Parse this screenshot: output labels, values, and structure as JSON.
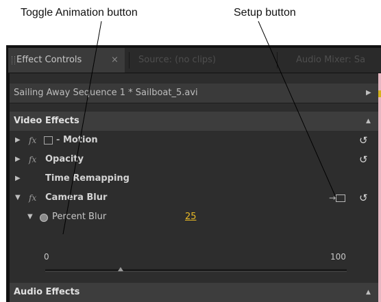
{
  "callouts": {
    "toggle_animation": "Toggle Animation button",
    "setup": "Setup button"
  },
  "tabs": [
    {
      "label": "Effect Controls",
      "active": true,
      "close": "×"
    },
    {
      "label": "Source: (no clips)",
      "active": false
    },
    {
      "label": "Audio Mixer: Sa",
      "active": false
    }
  ],
  "sequence": {
    "label": "Sailing Away Sequence 1 * Sailboat_5.avi"
  },
  "video_effects": {
    "header": "Video Effects",
    "items": [
      {
        "label": "Motion",
        "fx": "fx",
        "expanded": false,
        "has_reset": true
      },
      {
        "label": "Opacity",
        "fx": "fx",
        "expanded": false,
        "has_reset": true
      },
      {
        "label": "Time Remapping",
        "fx": "",
        "expanded": false,
        "has_reset": false
      },
      {
        "label": "Camera Blur",
        "fx": "fx",
        "expanded": true,
        "has_reset": true,
        "has_setup": true
      }
    ]
  },
  "percent_blur": {
    "label": "Percent Blur",
    "value": "25",
    "slider_min": "0",
    "slider_max": "100",
    "slider_value": 25
  },
  "audio_effects": {
    "header": "Audio Effects"
  },
  "colors": {
    "panel_bg": "#2d2d2d",
    "header_bg": "#3d3d3d",
    "value_yellow": "#e7b826"
  }
}
